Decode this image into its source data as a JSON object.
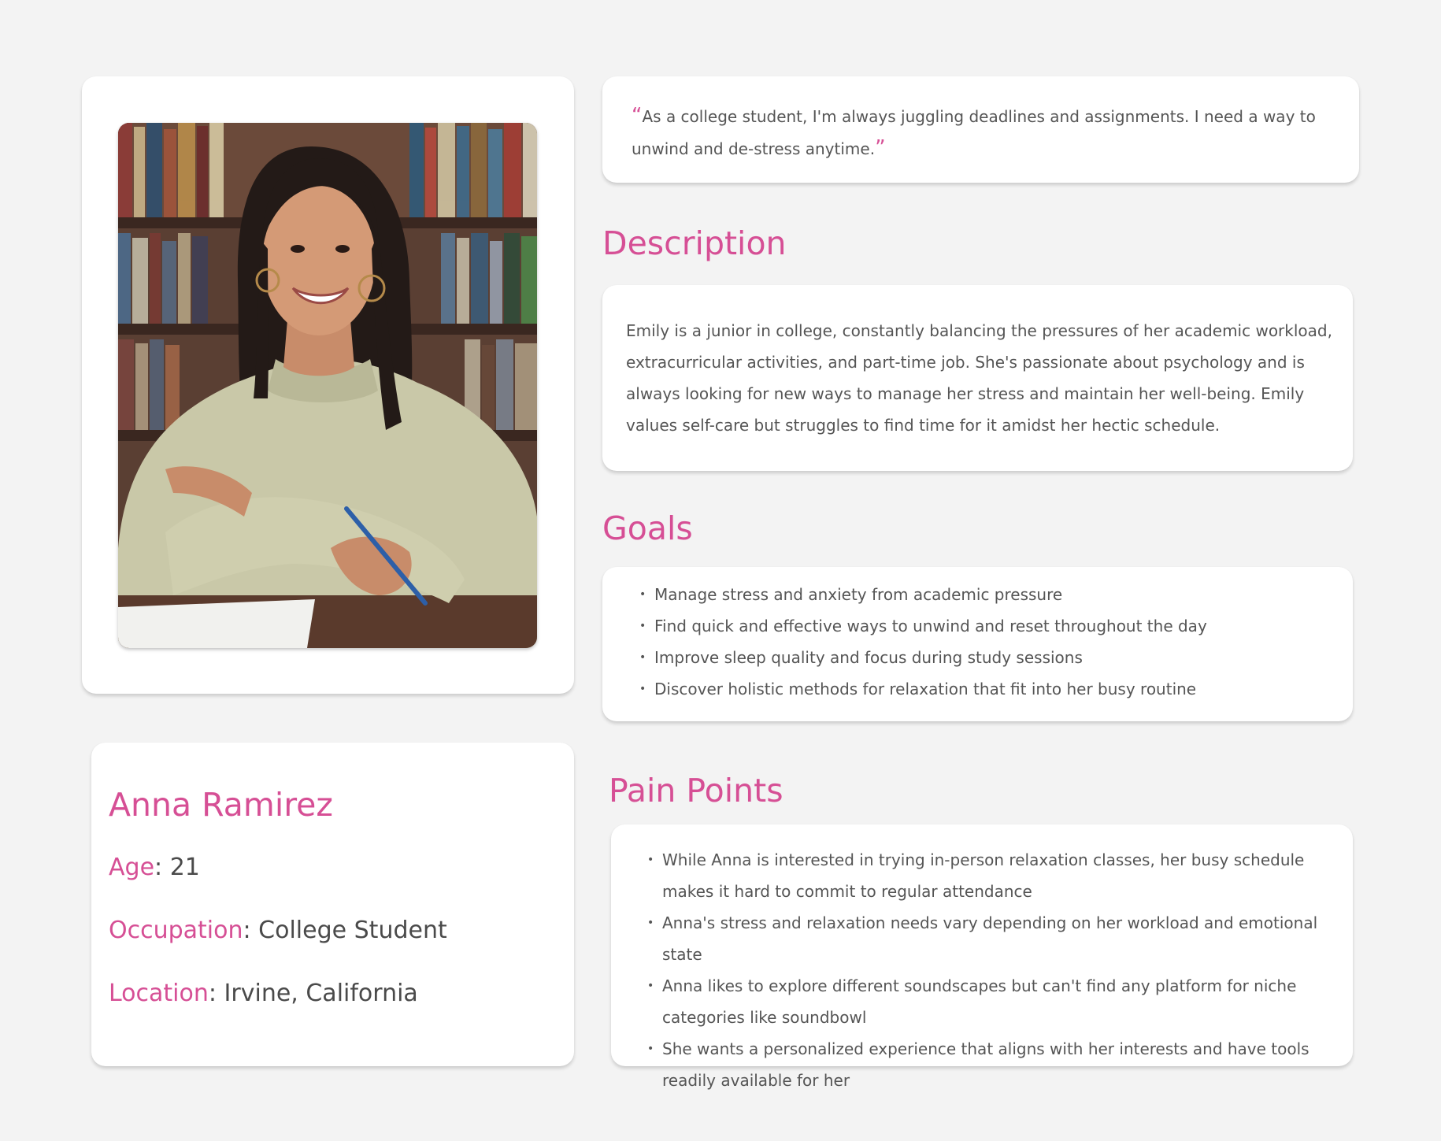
{
  "quote": {
    "open_mark": "“",
    "text": "As a college student, I'm always juggling deadlines and assignments. I need a way to unwind and de-stress anytime.",
    "close_mark": "”"
  },
  "persona": {
    "name": "Anna Ramirez",
    "age_label": "Age",
    "age_value": "21",
    "occupation_label": "Occupation",
    "occupation_value": "College Student",
    "location_label": "Location",
    "location_value": "Irvine, California",
    "separator": ": "
  },
  "description": {
    "title": "Description",
    "text": "Emily is a junior in college, constantly balancing the pressures of her academic workload, extracurricular activities, and part-time job. She's passionate about psychology and is always looking for new ways to manage her stress and maintain her well-being. Emily values self-care but struggles to find time for it amidst her hectic schedule."
  },
  "goals": {
    "title": "Goals",
    "items": [
      "Manage stress and anxiety from academic pressure",
      "Find quick and effective ways to unwind and reset throughout the day",
      "Improve sleep quality and focus during study sessions",
      "Discover holistic methods for relaxation that fit into her busy routine"
    ]
  },
  "pain_points": {
    "title": "Pain Points",
    "items": [
      "While Anna is interested in trying in-person relaxation classes, her busy schedule makes it hard to commit to regular attendance",
      "Anna's stress and relaxation needs vary depending on her workload and emotional state",
      "Anna likes to explore different soundscapes but can't find any platform for niche categories like soundbowl",
      "She wants a personalized experience that aligns with her interests and have tools readily available for her"
    ]
  },
  "colors": {
    "accent": "#d64f95",
    "background": "#f3f3f3",
    "card": "#ffffff",
    "body_text": "#555555"
  }
}
